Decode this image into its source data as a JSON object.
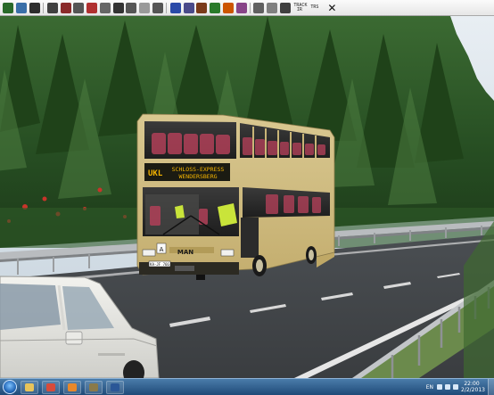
{
  "toolbar": {
    "buttons": [
      {
        "icon": "game-icon",
        "color": "#2a6a2a"
      },
      {
        "icon": "map-icon",
        "color": "#3a6fa8"
      },
      {
        "icon": "save-icon",
        "color": "#2d2d2d"
      },
      {
        "icon": "bus-icon",
        "color": "#404040"
      },
      {
        "icon": "bus-front-icon",
        "color": "#8a2a2a"
      },
      {
        "icon": "truck-icon",
        "color": "#555555"
      },
      {
        "icon": "tool-icon",
        "color": "#b03030"
      },
      {
        "icon": "window-icon",
        "color": "#666666"
      },
      {
        "icon": "person-icon",
        "color": "#333333"
      },
      {
        "icon": "wrench-icon",
        "color": "#555555"
      },
      {
        "icon": "document-icon",
        "color": "#999999"
      },
      {
        "icon": "film-icon",
        "color": "#555555"
      },
      {
        "icon": "bell-icon",
        "color": "#2a4aa8"
      },
      {
        "icon": "hat-icon",
        "color": "#4a4a8a"
      },
      {
        "icon": "book-icon",
        "color": "#7a3a1a"
      },
      {
        "icon": "chart-icon",
        "color": "#2a7a2a"
      },
      {
        "icon": "timetable-icon",
        "color": "#cc5500"
      },
      {
        "icon": "route-icon",
        "color": "#884488"
      },
      {
        "icon": "clock-icon",
        "color": "#606060"
      },
      {
        "icon": "weather-icon",
        "color": "#808080"
      },
      {
        "icon": "speed-icon",
        "color": "#404040"
      }
    ],
    "track_label": "TRACK IR",
    "extra_label": "TRS",
    "close_label": "✕"
  },
  "bus": {
    "route_number": "UKL",
    "destination_line1": "SCHLOSS-EXPRESS",
    "destination_line2": "WENDERSBERG",
    "brand": "MAN",
    "plate": "KA-JF 766"
  },
  "taskbar": {
    "apps": [
      {
        "icon": "folder-icon",
        "color": "#e8c45a"
      },
      {
        "icon": "chrome-icon",
        "color": "#d84b3a"
      },
      {
        "icon": "media-player-icon",
        "color": "#e8882a"
      },
      {
        "icon": "omsi-icon",
        "color": "#8a7a4a"
      },
      {
        "icon": "word-icon",
        "color": "#2b5797"
      }
    ],
    "language": "EN",
    "time": "22:00",
    "date": "2/2/2013"
  }
}
